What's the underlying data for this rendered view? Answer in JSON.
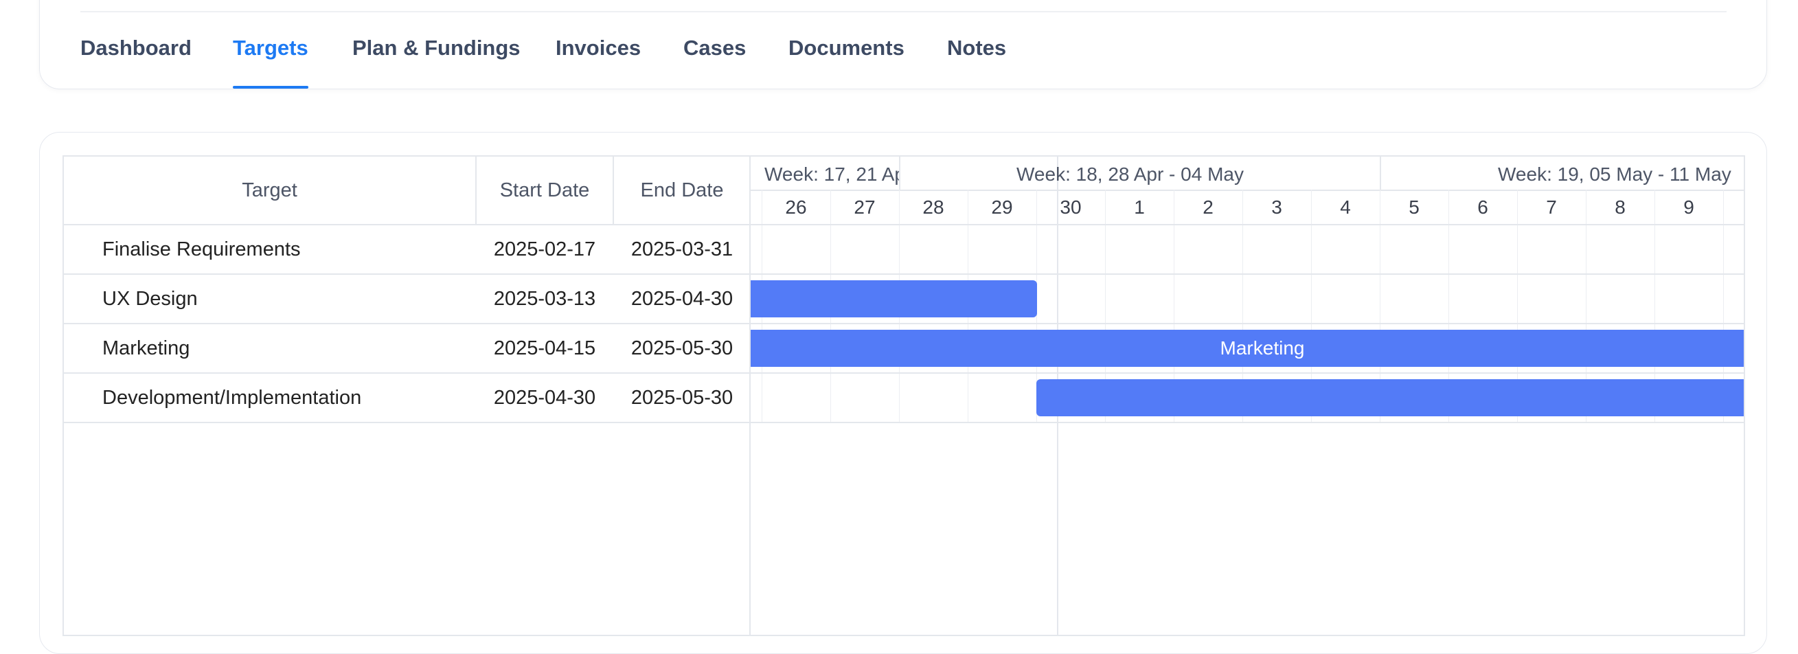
{
  "tabs": [
    {
      "label": "Dashboard",
      "active": false
    },
    {
      "label": "Targets",
      "active": true
    },
    {
      "label": "Plan & Fundings",
      "active": false
    },
    {
      "label": "Invoices",
      "active": false
    },
    {
      "label": "Cases",
      "active": false
    },
    {
      "label": "Documents",
      "active": false
    },
    {
      "label": "Notes",
      "active": false
    }
  ],
  "grid": {
    "headers": {
      "target": "Target",
      "start": "Start Date",
      "end": "End Date"
    },
    "rows": [
      {
        "target": "Finalise Requirements",
        "start": "2025-02-17",
        "end": "2025-03-31"
      },
      {
        "target": "UX Design",
        "start": "2025-03-13",
        "end": "2025-04-30"
      },
      {
        "target": "Marketing",
        "start": "2025-04-15",
        "end": "2025-05-30"
      },
      {
        "target": "Development/Implementation",
        "start": "2025-04-30",
        "end": "2025-05-30"
      }
    ]
  },
  "timeline": {
    "weeks": [
      "Week: 17, 21 Ap",
      "Week: 18, 28 Apr - 04 May",
      "Week: 19, 05 May - 11 May"
    ],
    "days": [
      "26",
      "27",
      "28",
      "29",
      "30",
      "1",
      "2",
      "3",
      "4",
      "5",
      "6",
      "7",
      "8",
      "9"
    ],
    "bars": [
      {
        "row": "UX Design",
        "label": ""
      },
      {
        "row": "Marketing",
        "label": "Marketing"
      },
      {
        "row": "Development/Implementation",
        "label": ""
      }
    ]
  },
  "colors": {
    "accent": "#1d7af3",
    "bar": "#537bf7",
    "tab_text": "#3d4a63"
  }
}
